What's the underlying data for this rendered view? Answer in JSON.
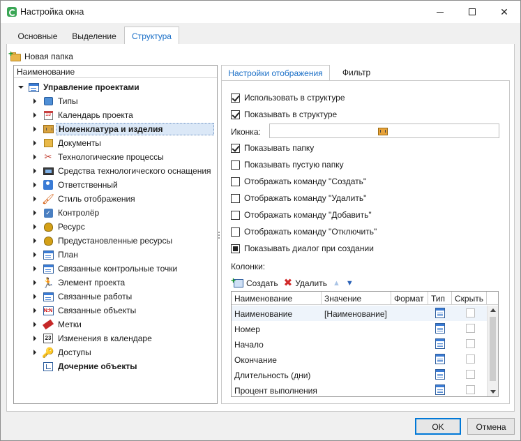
{
  "window": {
    "title": "Настройка окна"
  },
  "tabs": [
    {
      "label": "Основные"
    },
    {
      "label": "Выделение"
    },
    {
      "label": "Структура"
    }
  ],
  "toolbar": {
    "new_folder_label": "Новая папка"
  },
  "tree": {
    "header": "Наименование",
    "root": {
      "label": "Управление проектами",
      "icon": "window-icon"
    },
    "items": [
      {
        "label": "Типы",
        "icon": "cube-icon"
      },
      {
        "label": "Календарь проекта",
        "icon": "calendar-icon"
      },
      {
        "label": "Номенклатура и изделия",
        "icon": "box-icon"
      },
      {
        "label": "Документы",
        "icon": "document-icon"
      },
      {
        "label": "Технологические процессы",
        "icon": "tools-icon"
      },
      {
        "label": "Средства технологического оснащения",
        "icon": "monitor-icon"
      },
      {
        "label": "Ответственный",
        "icon": "user-icon"
      },
      {
        "label": "Стиль отображения",
        "icon": "brush-icon"
      },
      {
        "label": "Контролёр",
        "icon": "controller-icon"
      },
      {
        "label": "Ресурс",
        "icon": "bag-icon"
      },
      {
        "label": "Предустановленные ресурсы",
        "icon": "bag-icon"
      },
      {
        "label": "План",
        "icon": "window-icon"
      },
      {
        "label": "Связанные контрольные точки",
        "icon": "window-icon"
      },
      {
        "label": "Элемент проекта",
        "icon": "runner-icon"
      },
      {
        "label": "Связанные работы",
        "icon": "window-icon"
      },
      {
        "label": "Связанные объекты",
        "icon": "link-icon"
      },
      {
        "label": "Метки",
        "icon": "tag-icon"
      },
      {
        "label": "Изменения в календаре",
        "icon": "calendar-23-icon"
      },
      {
        "label": "Доступы",
        "icon": "key-icon"
      },
      {
        "label": "Дочерние объекты",
        "icon": "child-icon"
      }
    ],
    "calendar_glyph": "13",
    "controller_glyph": "✓",
    "link_glyph": "N:N",
    "calendar23_glyph": "23"
  },
  "right_tabs": [
    {
      "label": "Настройки отображения"
    },
    {
      "label": "Фильтр"
    }
  ],
  "settings": {
    "use_in_structure": "Использовать в структуре",
    "show_in_structure": "Показывать в структуре",
    "icon_label": "Иконка:",
    "show_folder": "Показывать папку",
    "show_empty_folder": "Показывать пустую папку",
    "cmd_create": "Отображать команду \"Создать\"",
    "cmd_delete": "Отображать команду \"Удалить\"",
    "cmd_add": "Отображать команду \"Добавить\"",
    "cmd_disable": "Отображать команду \"Отключить\"",
    "show_dialog": "Показывать диалог при создании",
    "columns_label": "Колонки:"
  },
  "columns_toolbar": {
    "create": "Создать",
    "delete": "Удалить"
  },
  "grid": {
    "headers": [
      "Наименование",
      "Значение",
      "Формат",
      "Тип",
      "Скрыть"
    ],
    "rows": [
      {
        "name": "Наименование",
        "value": "[Наименование]"
      },
      {
        "name": "Номер",
        "value": ""
      },
      {
        "name": "Начало",
        "value": ""
      },
      {
        "name": "Окончание",
        "value": ""
      },
      {
        "name": "Длительность (дни)",
        "value": ""
      },
      {
        "name": "Процент выполнения",
        "value": ""
      }
    ]
  },
  "buttons": {
    "ok": "OK",
    "cancel": "Отмена"
  },
  "colors": {
    "accent": "#1a6fc7",
    "selection": "#dbe8f7"
  }
}
